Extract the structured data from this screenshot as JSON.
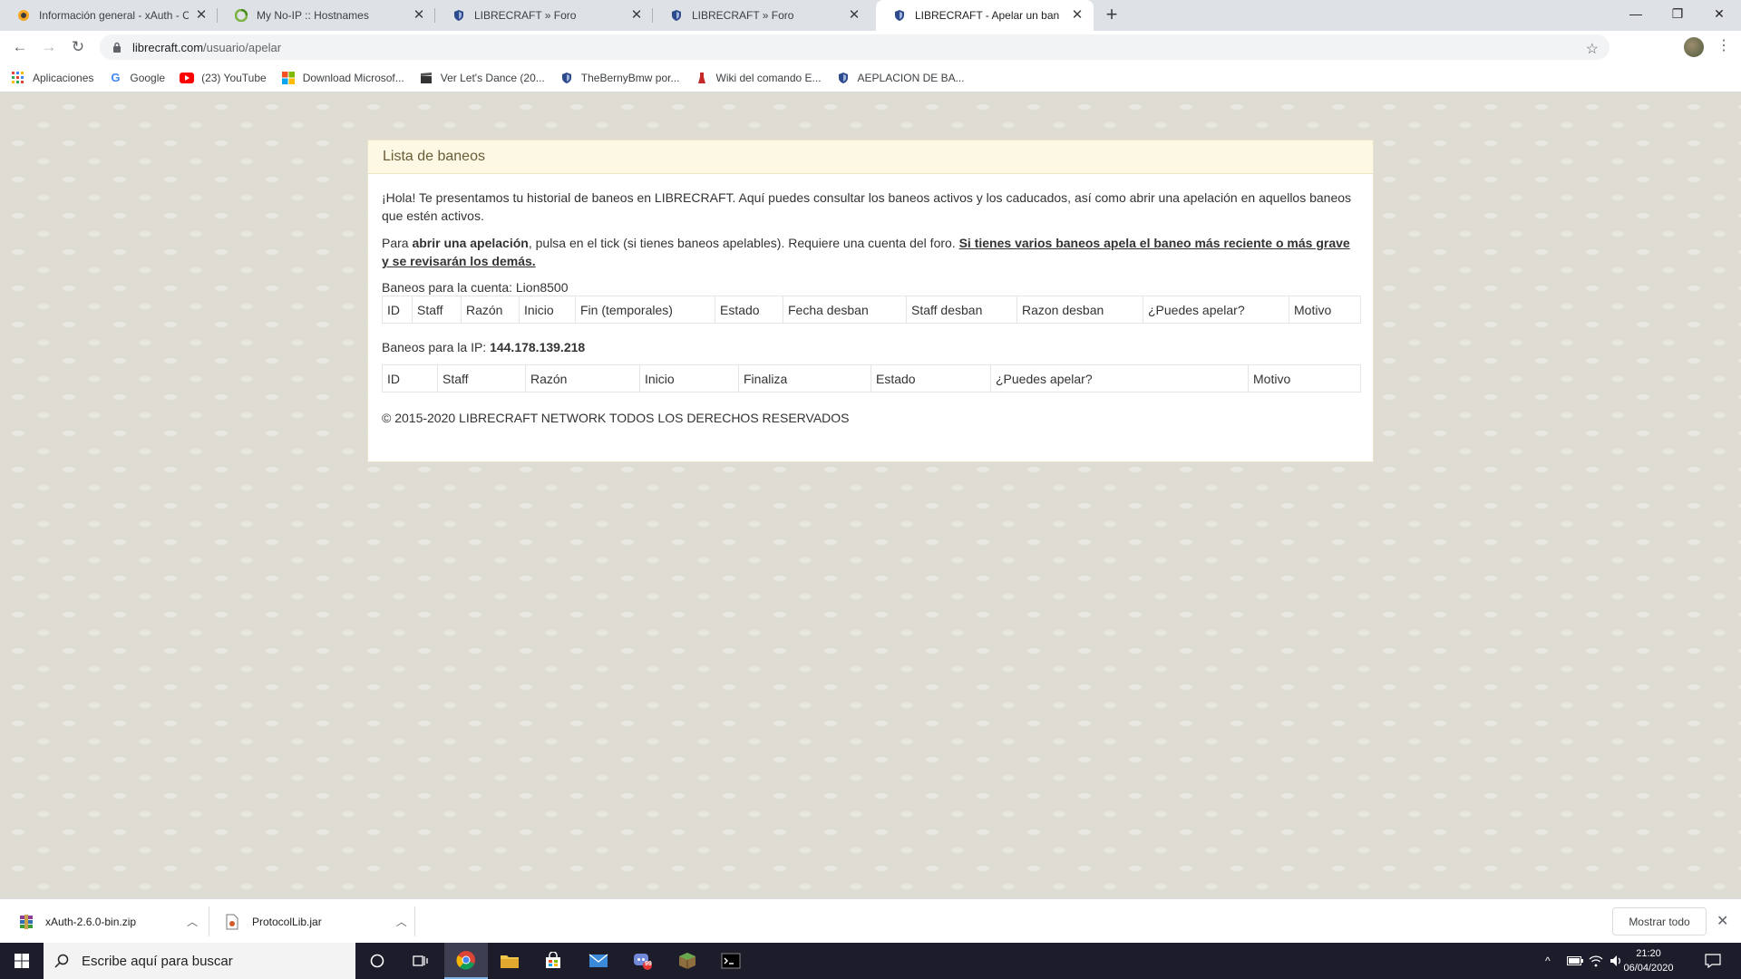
{
  "browser": {
    "tabs": [
      {
        "title": "Información general - xAuth - Co",
        "icon": "curse-icon",
        "active": false
      },
      {
        "title": "My No-IP :: Hostnames",
        "icon": "noip-icon",
        "active": false
      },
      {
        "title": "LIBRECRAFT » Foro",
        "icon": "shield-icon",
        "active": false
      },
      {
        "title": "LIBRECRAFT » Foro",
        "icon": "shield-icon",
        "active": false
      },
      {
        "title": "LIBRECRAFT - Apelar un ban",
        "icon": "shield-icon",
        "active": true
      }
    ],
    "url_domain": "librecraft.com",
    "url_path": "/usuario/apelar",
    "bookmarks": [
      {
        "label": "Aplicaciones",
        "icon": "apps-grid-icon"
      },
      {
        "label": "Google",
        "icon": "google-icon"
      },
      {
        "label": "(23) YouTube",
        "icon": "youtube-icon"
      },
      {
        "label": "Download Microsof...",
        "icon": "microsoft-icon"
      },
      {
        "label": "Ver Let's Dance (20...",
        "icon": "clapperboard-icon"
      },
      {
        "label": "TheBernyBmw por...",
        "icon": "shield-icon"
      },
      {
        "label": "Wiki del comando E...",
        "icon": "bookmark-icon"
      },
      {
        "label": "AEPLACION DE BA...",
        "icon": "shield-icon"
      }
    ]
  },
  "panel": {
    "heading": "Lista de baneos",
    "intro": "¡Hola! Te presentamos tu historial de baneos en LIBRECRAFT. Aquí puedes consultar los baneos activos y los caducados, así como abrir una apelación en aquellos baneos que estén activos.",
    "p2_prefix": "Para ",
    "p2_bold": "abrir una apelación",
    "p2_middle": ", pulsa en el tick (si tienes baneos apelables). Requiere una cuenta del foro. ",
    "p2_underline": "Si tienes varios baneos apela el baneo más reciente o más grave y se revisarán los demás.",
    "account_label": "Baneos para la cuenta: ",
    "account_name": "Lion8500",
    "account_table_headers": [
      "ID",
      "Staff",
      "Razón",
      "Inicio",
      "Fin (temporales)",
      "Estado",
      "Fecha desban",
      "Staff desban",
      "Razon desban",
      "¿Puedes apelar?",
      "Motivo"
    ],
    "ip_label": "Baneos para la IP: ",
    "ip_value": "144.178.139.218",
    "ip_table_headers": [
      "ID",
      "Staff",
      "Razón",
      "Inicio",
      "Finaliza",
      "Estado",
      "¿Puedes apelar?",
      "Motivo"
    ],
    "copyright": "© 2015-2020 LIBRECRAFT NETWORK TODOS LOS DERECHOS RESERVADOS"
  },
  "downloads": {
    "items": [
      {
        "filename": "xAuth-2.6.0-bin.zip",
        "icon": "archive-icon"
      },
      {
        "filename": "ProtocolLib.jar",
        "icon": "jar-file-icon"
      }
    ],
    "show_all": "Mostrar todo"
  },
  "taskbar": {
    "search_placeholder": "Escribe aquí para buscar",
    "time": "21:20",
    "date": "06/04/2020",
    "mail_badge": "99"
  }
}
